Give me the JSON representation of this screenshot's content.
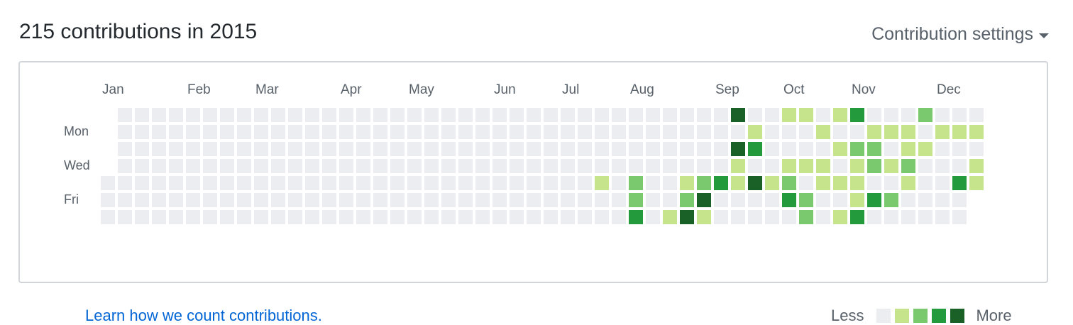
{
  "header": {
    "title": "215 contributions in 2015",
    "settings_label": "Contribution settings"
  },
  "graph": {
    "months": [
      "Jan",
      "Feb",
      "Mar",
      "Apr",
      "May",
      "Jun",
      "Jul",
      "Aug",
      "Sep",
      "Oct",
      "Nov",
      "Dec"
    ],
    "days": [
      "Mon",
      "Wed",
      "Fri"
    ],
    "levels": [
      "0000000000000000000000000000000000000000000000000000",
      "0000000000000000000000000000000000000400110130002000",
      "0000000000000000000000000000000000000010001001110111",
      "0000000000000000000000000000000000000430000122011000",
      "0000000000000000000000000000000000000100111012120001",
      "0000000000000000000000000000010200123141201110010031",
      "0000000000000000000000000000000200240000320013200001",
      "0000000000000000000000000000000301410000020130000000"
    ],
    "colors": [
      "#ebedf0",
      "#c6e48b",
      "#7bc96f",
      "#239a3b",
      "#196127"
    ]
  },
  "footer": {
    "learn_link": "Learn how we count contributions.",
    "legend_less": "Less",
    "legend_more": "More"
  }
}
